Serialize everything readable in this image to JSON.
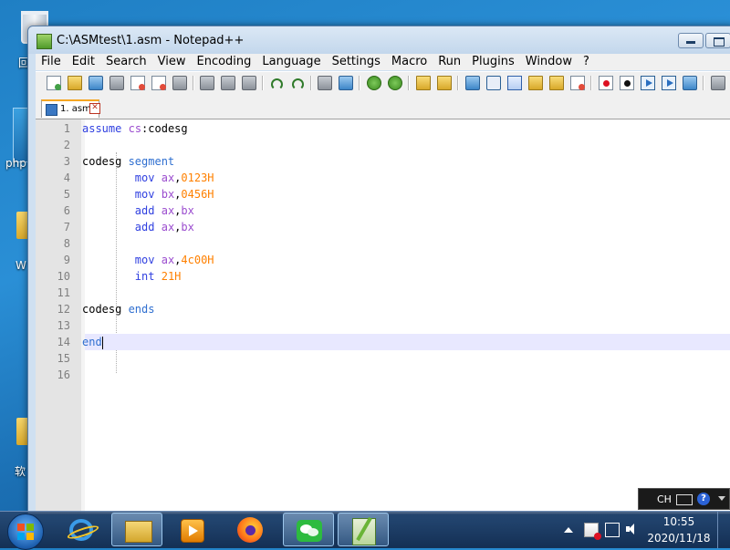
{
  "desktop": {
    "labels": [
      "回",
      "php",
      "W",
      "软"
    ]
  },
  "window": {
    "title": "C:\\ASMtest\\1.asm - Notepad++"
  },
  "menu": [
    "File",
    "Edit",
    "Search",
    "View",
    "Encoding",
    "Language",
    "Settings",
    "Macro",
    "Run",
    "Plugins",
    "Window",
    "?"
  ],
  "toolbar": {
    "icons": [
      "new-file-icon",
      "open-folder-icon",
      "save-icon",
      "save-all-icon",
      "close-icon",
      "close-all-icon",
      "print-icon",
      "cut-icon",
      "copy-icon",
      "paste-icon",
      "undo-icon",
      "redo-icon",
      "find-icon",
      "replace-icon",
      "zoom-in-icon",
      "zoom-out-icon",
      "sync-vertical-icon",
      "sync-horizontal-icon",
      "word-wrap-icon",
      "show-all-chars-icon",
      "indent-guide-icon",
      "user-lang-icon",
      "doc-map-icon",
      "function-list-icon",
      "record-macro-icon",
      "stop-record-icon",
      "play-macro-icon",
      "run-macro-multiple-icon",
      "save-macro-icon",
      "more-icon"
    ]
  },
  "tab": {
    "label": "1. asm",
    "close": "✕"
  },
  "editor": {
    "line_numbers": [
      "1",
      "2",
      "3",
      "4",
      "5",
      "6",
      "7",
      "8",
      "9",
      "10",
      "11",
      "12",
      "13",
      "14",
      "15",
      "16"
    ],
    "current_line": 14
  },
  "taskbar": {
    "lang": "CH",
    "help": "?",
    "time": "10:55",
    "date": "2020/11/18",
    "apps": [
      "ie-icon",
      "explorer-icon",
      "media-player-icon",
      "firefox-icon",
      "wechat-icon",
      "notepadpp-icon"
    ]
  },
  "colors": {
    "keyword": "#2f3fe0",
    "register": "#9b4dcf",
    "number": "#ff8000",
    "current_line_bg": "#e8e8ff"
  }
}
